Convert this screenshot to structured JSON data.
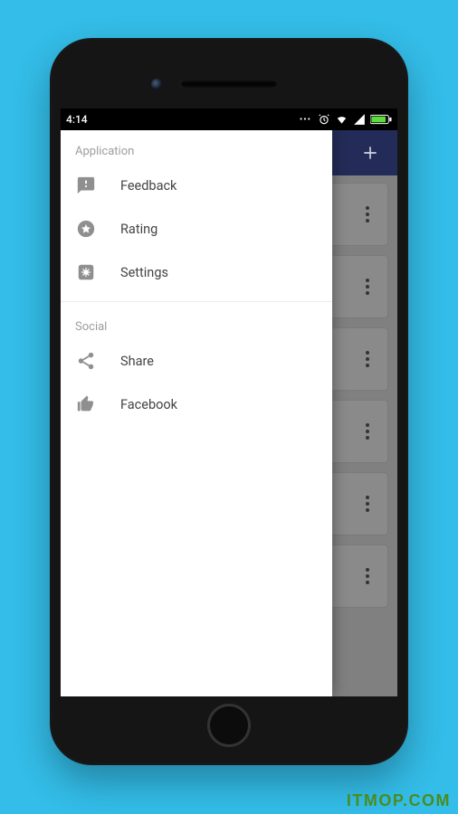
{
  "status_bar": {
    "time": "4:14"
  },
  "app_bar": {
    "add_icon_name": "plus-icon"
  },
  "drawer": {
    "sections": [
      {
        "title": "Application",
        "items": [
          {
            "label": "Feedback",
            "icon": "feedback-icon"
          },
          {
            "label": "Rating",
            "icon": "star-icon"
          },
          {
            "label": "Settings",
            "icon": "settings-icon"
          }
        ]
      },
      {
        "title": "Social",
        "items": [
          {
            "label": "Share",
            "icon": "share-icon"
          },
          {
            "label": "Facebook",
            "icon": "thumbs-up-icon"
          }
        ]
      }
    ]
  },
  "watermark": "ITMOP.COM"
}
